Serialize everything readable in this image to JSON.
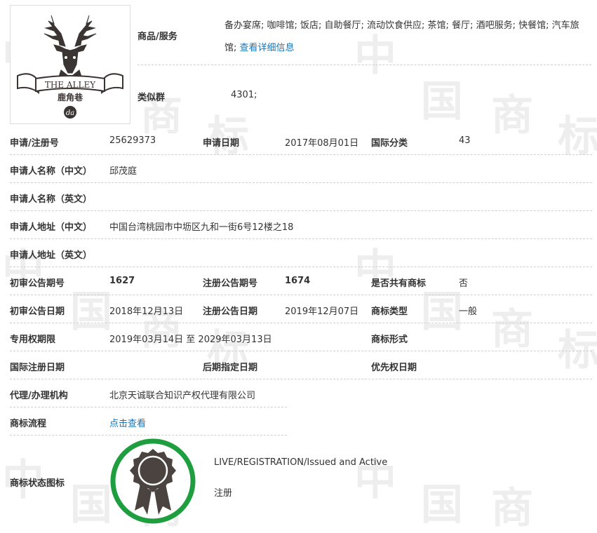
{
  "watermark": {
    "chars": [
      "中",
      "国",
      "商",
      "标"
    ]
  },
  "logo": {
    "brand_text": "THE ALLEY",
    "sub_text": "鹿角巷",
    "mark_text": "da"
  },
  "header": {
    "services_label": "商品/服务",
    "services_value": "备办宴席; 咖啡馆; 饭店; 自助餐厅; 流动饮食供应; 茶馆; 餐厅; 酒吧服务; 快餐馆; 汽车旅馆;",
    "services_link": "查看详细信息",
    "similar_group_label": "类似群",
    "similar_group_value": "4301;"
  },
  "fields": {
    "reg_no_label": "申请/注册号",
    "reg_no": "25629373",
    "apply_date_label": "申请日期",
    "apply_date": "2017年08月01日",
    "intl_class_label": "国际分类",
    "intl_class": "43",
    "applicant_cn_label": "申请人名称（中文）",
    "applicant_cn": "邱茂庭",
    "applicant_en_label": "申请人名称（英文）",
    "address_cn_label": "申请人地址（中文）",
    "address_cn": "中国台湾桃园市中坜区九和一街6号12楼之18",
    "address_en_label": "申请人地址（英文）",
    "prelim_issue_label": "初审公告期号",
    "prelim_issue": "1627",
    "reg_issue_label": "注册公告期号",
    "reg_issue": "1674",
    "shared_label": "是否共有商标",
    "shared": "否",
    "prelim_date_label": "初审公告日期",
    "prelim_date": "2018年12月13日",
    "reg_date_label": "注册公告日期",
    "reg_date": "2019年12月07日",
    "mark_type_label": "商标类型",
    "mark_type": "一般",
    "exclusive_label": "专用权期限",
    "exclusive_period": "2019年03月14日 至 2029年03月13日",
    "mark_form_label": "商标形式",
    "intl_reg_date_label": "国际注册日期",
    "later_designation_label": "后期指定日期",
    "priority_date_label": "优先权日期",
    "agent_label": "代理/办理机构",
    "agent": "北京天诚联合知识产权代理有限公司",
    "process_label": "商标流程",
    "process_link": "点击查看",
    "status_icon_label": "商标状态图标",
    "status_en": "LIVE/REGISTRATION/Issued and Active",
    "status_cn": "注册"
  },
  "colors": {
    "status_ring": "#1e9e3e",
    "badge": "#4a4340",
    "link": "#1a73b8"
  }
}
